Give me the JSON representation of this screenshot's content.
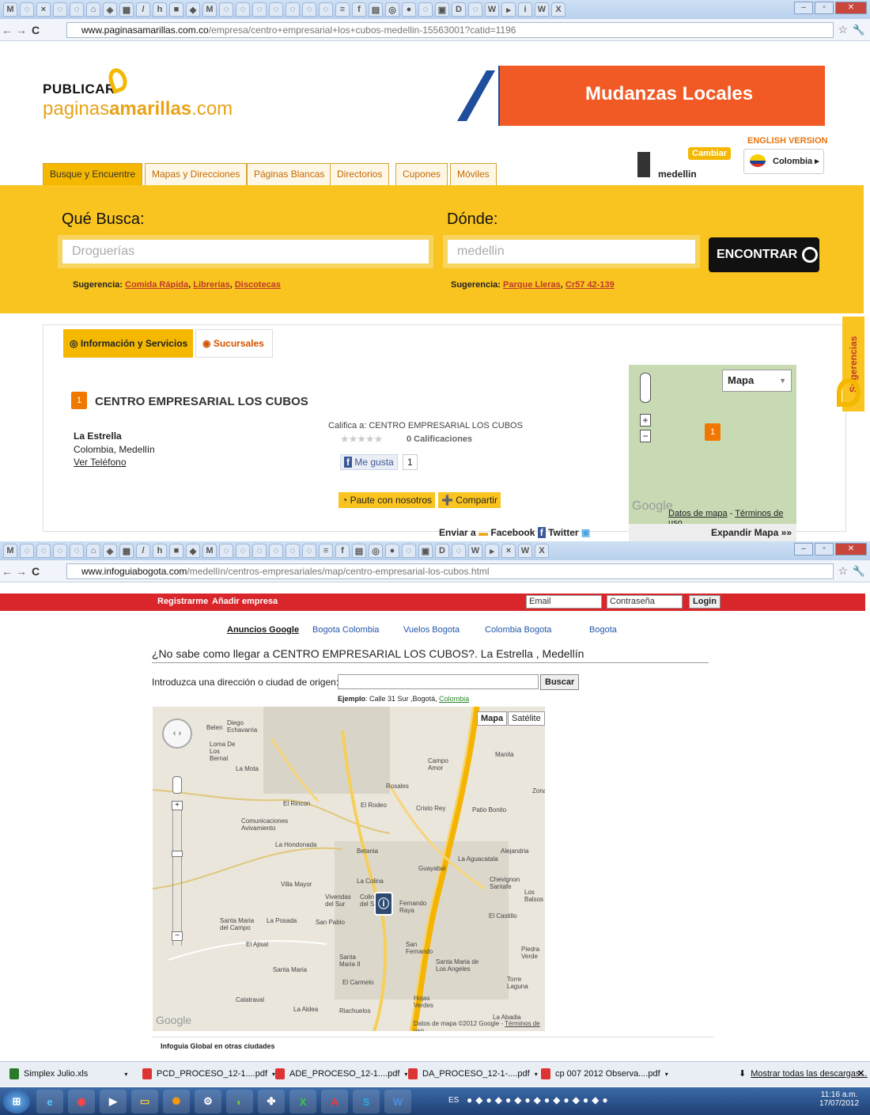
{
  "window1": {
    "url_domain": "www.paginasamarillas.com.co",
    "url_path": "/empresa/centro+empresarial+los+cubos-medellin-15563001?catid=1196",
    "logo_top": "PUBLICAR",
    "logo_main": "paginas",
    "logo_main_bold": "amarillas",
    "logo_suffix": ".com",
    "banner_title": "Mudanzas Locales",
    "english_version": "ENGLISH VERSION",
    "cambiar": "Cambiar",
    "city": "medellin",
    "country": "Colombia ▸",
    "tabs": [
      "Busque y Encuentre",
      "Mapas y Direcciones",
      "Páginas Blancas",
      "Directorios",
      "Cupones",
      "Móviles"
    ],
    "que_busca_label": "Qué Busca:",
    "donde_label": "Dónde:",
    "que_busca_placeholder": "Droguerías",
    "donde_placeholder": "medellin",
    "encontrar": "ENCONTRAR",
    "sugerencia_label": "Sugerencia:",
    "sug_left": [
      "Comida Rápida",
      "Librerías",
      "Discotecas"
    ],
    "sug_right": [
      "Parque Lleras",
      "Cr57 42-139"
    ],
    "info_tab": "Información y Servicios",
    "sucursales_tab": "Sucursales",
    "sugerencias_side": "Sugerencias",
    "listing": {
      "number": "1",
      "name": "CENTRO EMPRESARIAL LOS CUBOS",
      "locality": "La Estrella",
      "region": "Colombia, Medellín",
      "phone_link": "Ver Teléfono",
      "califica": "Califica a: CENTRO EMPRESARIAL LOS CUBOS",
      "calificaciones": "0 Calificaciones",
      "me_gusta": "Me gusta",
      "like_count": "1",
      "paute": "Paute con nosotros",
      "compartir": "Compartir",
      "enviar": "Enviar a",
      "facebook": "Facebook",
      "twitter": "Twitter"
    },
    "map": {
      "type_select": "Mapa",
      "zoom_in": "+",
      "zoom_out": "−",
      "pin": "1",
      "datos": "Datos de mapa",
      "terminos": "Términos de uso",
      "expandir": "Expandir Mapa »»",
      "google": "Google"
    }
  },
  "window2": {
    "url_domain": "www.infoguiabogota.com",
    "url_path": "/medellín/centros-empresariales/map/centro-empresarial-los-cubos.html",
    "registrarme": "Registrarme",
    "anadir": "Añadir empresa",
    "email_ph": "Email",
    "password_ph": "Contraseña",
    "login": "Login",
    "ads": [
      "Anuncios Google",
      "Bogota Colombia",
      "Vuelos Bogota",
      "Colombia Bogota",
      "Bogota"
    ],
    "heading": "¿No sabe como llegar a CENTRO EMPRESARIAL LOS CUBOS?. La Estrella , Medellín",
    "origin_label": "Introduzca una dirección o ciudad de origen:",
    "buscar": "Buscar",
    "ejemplo_label": "Ejemplo",
    "ejemplo_text": ": Calle 31 Sur ,Bogotá,",
    "ejemplo_link": "Colombia",
    "map_btn": "Mapa",
    "sat_btn": "Satélite",
    "map_credit": "Datos de mapa ©2012 Google -",
    "map_terms": "Términos de uso",
    "google": "Google",
    "infoguia": "Infoguia Global en otras ciudades",
    "places": [
      "Belen",
      "Diego Echavarria",
      "Loma De Los Bernal",
      "La Mota",
      "Campo Amor",
      "Rosales",
      "Manila",
      "Zona",
      "El Rincon",
      "El Rodeo",
      "Cristo Rey",
      "Patio Bonito",
      "Comunicaciones Avivamiento",
      "La Hondonada",
      "Betania",
      "La Aguacatala",
      "Alejandria",
      "Guayabal",
      "Villa Mayor",
      "La Colina",
      "Chevignon Santafe",
      "Vivendas del Sur",
      "Fernando Raya",
      "El Castillo",
      "Los Balsos",
      "Santa Maria del Campo",
      "La Posada",
      "San Pablo",
      "El Ajisal",
      "San Fernando",
      "Piedra Verde",
      "Santa Maria",
      "Santa Maria II",
      "Santa Maria de Los Angeles",
      "El Carmelo",
      "Torre Laguna",
      "Calatraval",
      "La Aldea",
      "Riachuelos",
      "Hojas Verdes",
      "La Abadia",
      "Colina del S"
    ]
  },
  "downloads": {
    "items": [
      "Simplex Julio.xls",
      "PCD_PROCESO_12-1....pdf",
      "ADE_PROCESO_12-1....pdf",
      "DA_PROCESO_12-1-....pdf",
      "cp 007 2012 Observa....pdf"
    ],
    "show_all": "Mostrar todas las descargas..."
  },
  "taskbar": {
    "lang": "ES",
    "time": "11:16 a.m.",
    "date": "17/07/2012"
  },
  "colors": {
    "yellow": "#f9c420",
    "orange": "#f15a24",
    "red": "#d8262b"
  }
}
